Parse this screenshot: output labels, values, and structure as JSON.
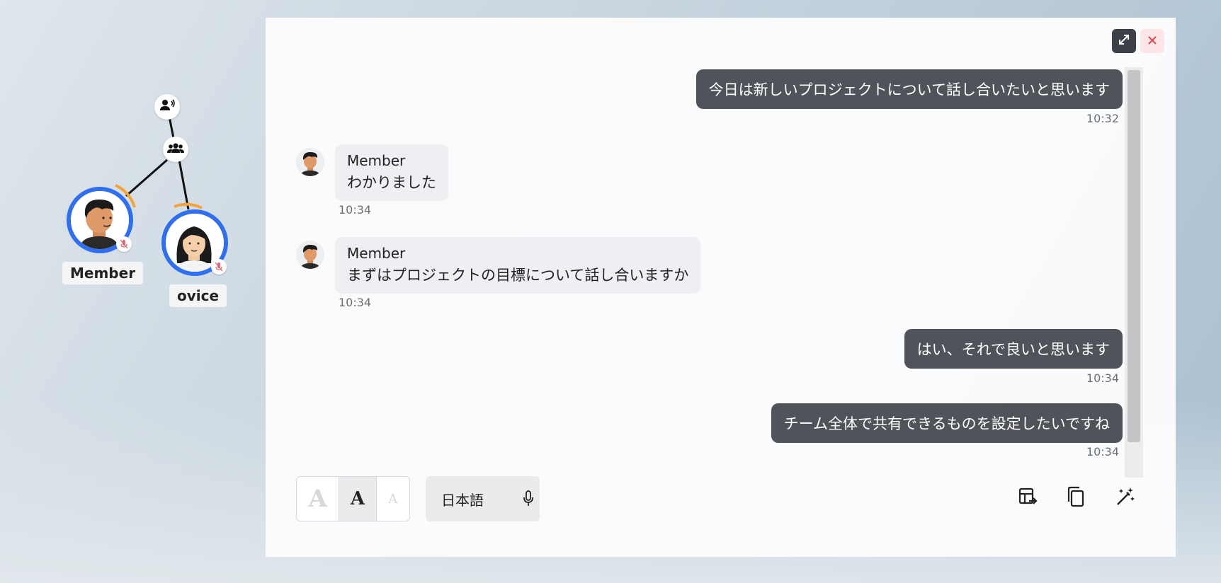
{
  "graph": {
    "nodes": [
      {
        "name": "Member"
      },
      {
        "name": "ovice"
      }
    ],
    "top_icon": "person-speaking-icon",
    "group_icon": "group-icon"
  },
  "chat": {
    "messages": [
      {
        "side": "right",
        "text": "今日は新しいプロジェクトについて話し合いたいと思います",
        "time": "10:32"
      },
      {
        "side": "left",
        "sender": "Member",
        "text": "わかりました",
        "time": "10:34"
      },
      {
        "side": "left",
        "sender": "Member",
        "text": "まずはプロジェクトの目標について話し合いますか",
        "time": "10:34"
      },
      {
        "side": "right",
        "text": "はい、それで良いと思います",
        "time": "10:34"
      },
      {
        "side": "right",
        "text": "チーム全体で共有できるものを設定したいですね",
        "time": "10:34"
      }
    ]
  },
  "toolbar": {
    "font_sizes": [
      "A",
      "A",
      "A"
    ],
    "selected_font_size": "medium",
    "language": "日本語",
    "icons": [
      "table-export-icon",
      "copy-icon",
      "magic-wand-icon"
    ]
  },
  "window": {
    "expand_icon": "expand-icon",
    "close_icon": "close-icon"
  },
  "colors": {
    "avatar_ring": "#2f6ff0",
    "self_bubble": "#50535a",
    "other_bubble": "#efeef2",
    "close_accent": "#e0474f"
  }
}
